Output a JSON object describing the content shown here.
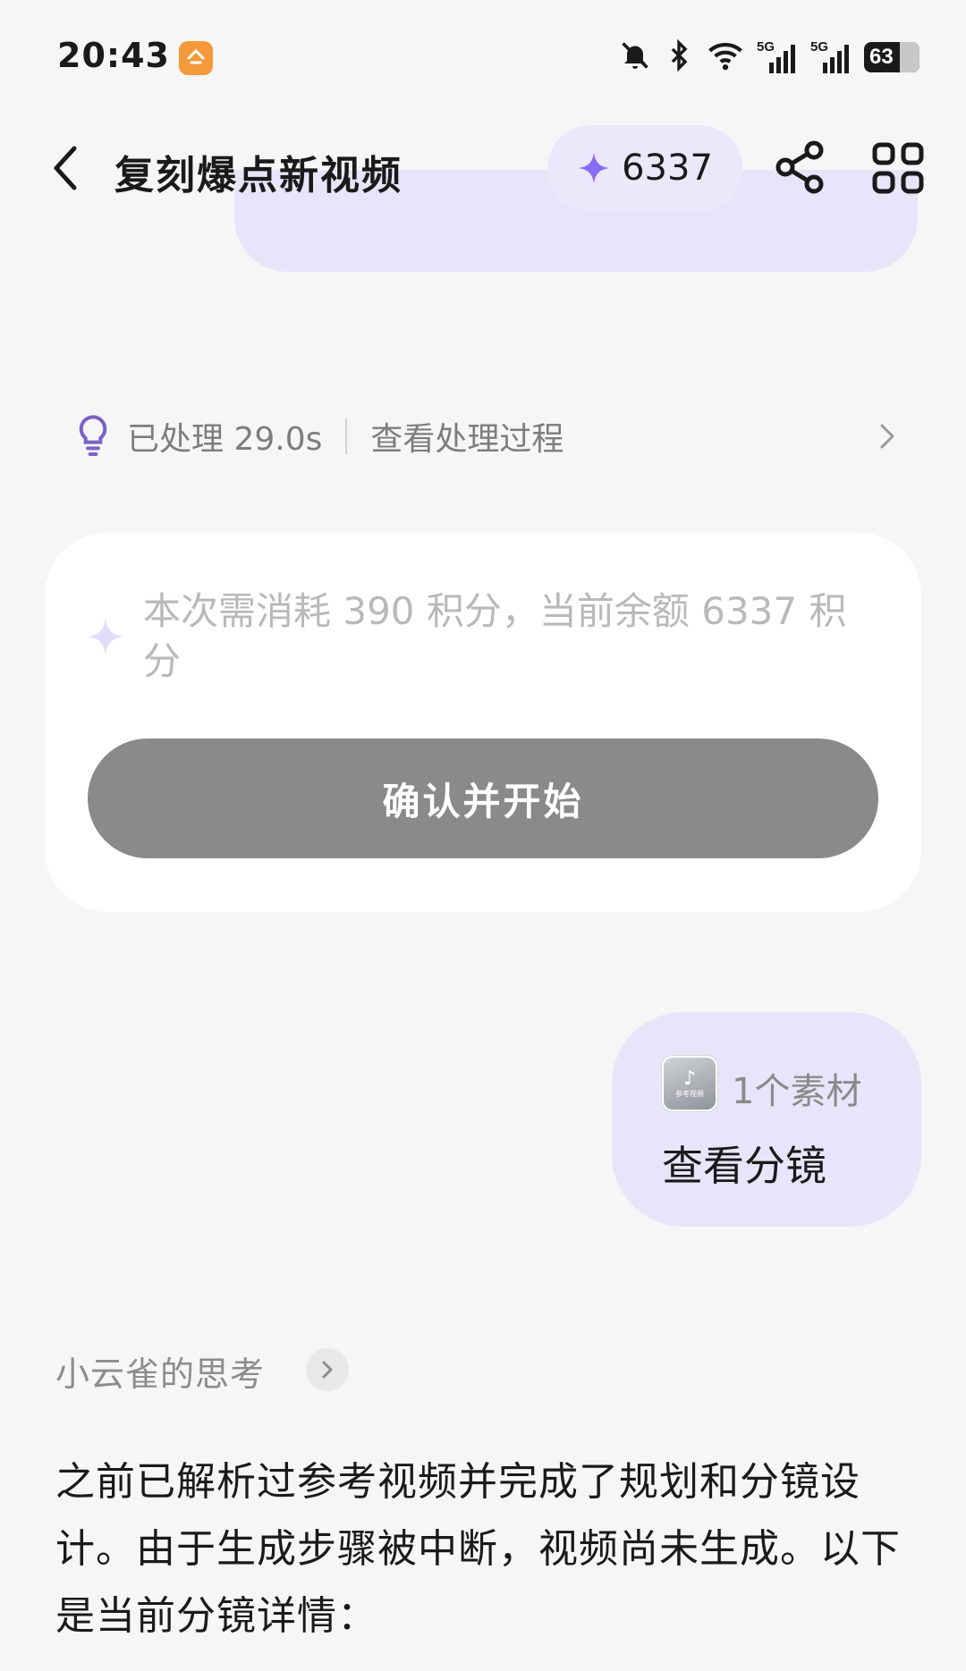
{
  "status_bar": {
    "time": "20:43",
    "app_icon": "orange-app-icon",
    "icons": [
      "mute-icon",
      "bluetooth-icon",
      "wifi-icon",
      "signal-5g-icon",
      "signal-5g-icon"
    ],
    "signal_label_1": "5G",
    "signal_label_2": "5G",
    "battery": "63"
  },
  "header": {
    "title": "复刻爆点新视频",
    "points": "6337",
    "accent_color": "#8b6cf6"
  },
  "processing": {
    "duration_text": "已处理 29.0s",
    "link_text": "查看处理过程"
  },
  "confirm_card": {
    "cost_text": "本次需消耗 390 积分，当前余额 6337 积分",
    "confirm_label": "确认并开始"
  },
  "user_message": {
    "material_count": "1个素材",
    "thumb_caption": "参考视频",
    "text": "查看分镜"
  },
  "assistant": {
    "thinking_label": "小云雀的思考",
    "reply": "之前已解析过参考视频并完成了规划和分镜设计。由于生成步骤被中断，视频尚未生成。以下是当前分镜详情："
  }
}
